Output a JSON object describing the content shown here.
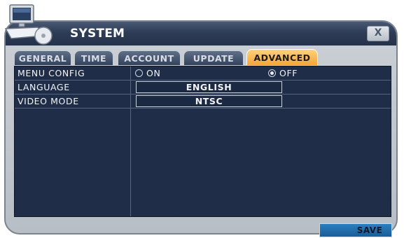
{
  "window": {
    "title": "SYSTEM",
    "close_label": "X"
  },
  "tabs": [
    {
      "label": "GENERAL",
      "active": false
    },
    {
      "label": "TIME",
      "active": false
    },
    {
      "label": "ACCOUNT",
      "active": false
    },
    {
      "label": "UPDATE",
      "active": false
    },
    {
      "label": "ADVANCED",
      "active": true
    }
  ],
  "settings": {
    "menu_config": {
      "label": "MENU CONFIG",
      "options": [
        "ON",
        "OFF"
      ],
      "selected": "OFF"
    },
    "language": {
      "label": "LANGUAGE",
      "value": "ENGLISH"
    },
    "video_mode": {
      "label": "VIDEO MODE",
      "value": "NTSC"
    }
  },
  "footer": {
    "save_label": "SAVE"
  },
  "colors": {
    "accent_tab": "#f5a53c",
    "panel": "#1f2d48",
    "save": "#1a5d97"
  },
  "icons": {
    "app": "computer-icon",
    "close": "close-icon"
  }
}
